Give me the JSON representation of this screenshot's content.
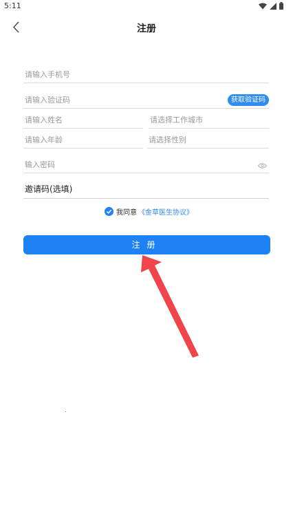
{
  "status_bar": {
    "time": "5:11"
  },
  "header": {
    "title": "注册"
  },
  "form": {
    "phone_placeholder": "请输入手机号",
    "code_placeholder": "请输入验证码",
    "get_code_label": "获取验证码",
    "name_placeholder": "请输入姓名",
    "city_placeholder": "请选择工作城市",
    "age_placeholder": "请输入年龄",
    "gender_placeholder": "请选择性别",
    "password_placeholder": "输入密码",
    "invite_label": "邀请码(选填)"
  },
  "agreement": {
    "agree_text": "我同意",
    "link_text": "《金草医生协议》",
    "checked": true
  },
  "register_button": {
    "label": "注册"
  },
  "colors": {
    "accent": "#1e82f5",
    "annotation_arrow": "#f0454a"
  }
}
